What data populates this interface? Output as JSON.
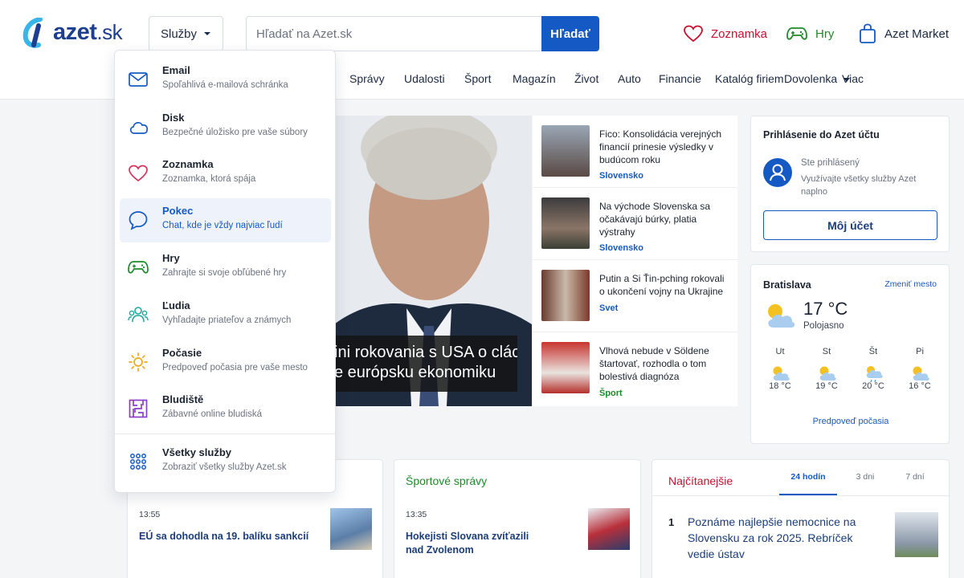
{
  "header": {
    "logo_text": "azet",
    "logo_suffix": ".sk",
    "services_label": "Služby",
    "search_placeholder": "Hľadať na Azet.sk",
    "search_button": "Hľadať",
    "links": {
      "dating": "Zoznamka",
      "games": "Hry",
      "market": "Azet Market"
    }
  },
  "nav": [
    "Správy",
    "Udalosti",
    "Šport",
    "Magazín",
    "Život",
    "Auto",
    "Financie",
    "Katalóg firiem",
    "Dovolenka",
    "Viac"
  ],
  "dropdown": [
    {
      "title": "Email",
      "desc": "Spoľahlivá e-mailová schránka",
      "icon": "mail-icon"
    },
    {
      "title": "Disk",
      "desc": "Bezpečné úložisko pre vaše súbory",
      "icon": "cloud-icon"
    },
    {
      "title": "Zoznamka",
      "desc": "Zoznamka, ktorá spája",
      "icon": "heart-icon"
    },
    {
      "title": "Pokec",
      "desc": "Chat, kde je vždy najviac ľudí",
      "icon": "chat-icon"
    },
    {
      "title": "Hry",
      "desc": "Zahrajte si svoje obľúbené hry",
      "icon": "gamepad-icon"
    },
    {
      "title": "Ľudia",
      "desc": "Vyhľadajte priateľov a známych",
      "icon": "people-icon"
    },
    {
      "title": "Počasie",
      "desc": "Predpoveď počasia pre vaše mesto",
      "icon": "sun-icon"
    },
    {
      "title": "Bludiště",
      "desc": "Zábavné online bludiská",
      "icon": "maze-icon"
    },
    {
      "title": "Všetky služby",
      "desc": "Zobraziť všetky služby Azet.sk",
      "icon": "grid-icon"
    }
  ],
  "hero": {
    "caption_line1": "ini rokovania s USA o clách",
    "caption_line2": "e európsku ekonomiku"
  },
  "news": [
    {
      "title": "Fico: Konsolidácia verejných financií prinesie výsledky v budúcom roku",
      "tag": "Slovensko"
    },
    {
      "title": "Na východe Slovenska sa očakávajú búrky, platia výstrahy",
      "tag": "Slovensko"
    },
    {
      "title": "Putin a Si Ťin-pching rokovali o ukončení vojny na Ukrajine",
      "tag": "Svet"
    },
    {
      "title": "Vlhová nebude v Söldene štartovať, rozhodla o tom bolestivá diagnóza",
      "tag": "Šport"
    }
  ],
  "login": {
    "heading": "Prihlásenie do Azet účtu",
    "status": "Ste prihlásený",
    "desc": "Využívajte všetky služby Azet naplno",
    "button": "Môj účet"
  },
  "weather": {
    "city": "Bratislava",
    "change": "Zmeniť mesto",
    "temp": "17 °C",
    "condition": "Polojasno",
    "forecast": [
      {
        "day": "Ut",
        "temp": "18 °C"
      },
      {
        "day": "St",
        "temp": "19 °C"
      },
      {
        "day": "Št",
        "temp": "20 °C"
      },
      {
        "day": "Pi",
        "temp": "16 °C"
      }
    ],
    "link": "Predpoveď počasia"
  },
  "bottom": {
    "col1": {
      "time": "13:55",
      "title": "EÚ sa dohodla na 19. balíku sankcií"
    },
    "sport": {
      "heading": "Športové správy",
      "time": "13:35",
      "title": "Hokejisti Slovana zvíťazili nad Zvolenom"
    },
    "top": {
      "heading": "Najčítanejšie",
      "tabs": [
        "24 hodín",
        "3 dni",
        "7 dní"
      ],
      "item_num": "1",
      "item_title": "Poznáme najlepšie nemocnice na Slovensku za rok 2025. Rebríček vedie ústav"
    }
  },
  "colors": {
    "brand": "#1559c5",
    "red": "#c8102e",
    "green": "#1d8a2a"
  }
}
